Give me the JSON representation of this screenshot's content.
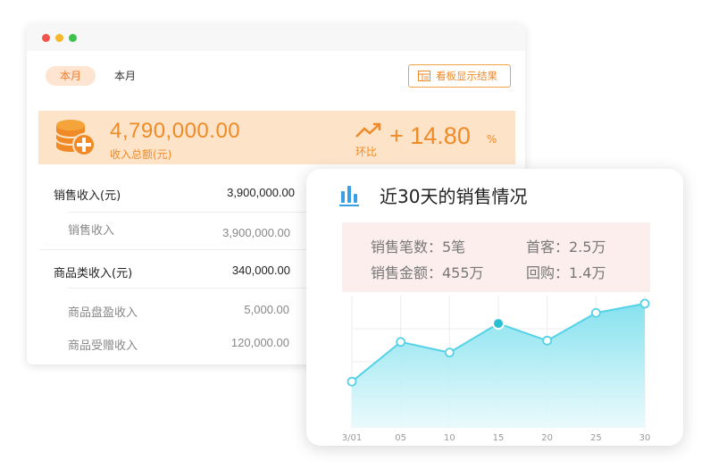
{
  "window": {
    "tabs": [
      "本月",
      "本月"
    ],
    "board_button": "看板显示结果",
    "summary": {
      "total_value": "4,790,000.00",
      "total_label": "收入总额(元)",
      "ratio_label": "环比",
      "ratio_value": "+ 14.80",
      "ratio_unit": "%"
    },
    "rows": [
      {
        "label": "销售收入(元)",
        "value": "3,900,000.00",
        "level": "main"
      },
      {
        "label": "销售收入",
        "value": "3,900,000.00",
        "level": "sub"
      },
      {
        "label": "商品类收入(元)",
        "value": "340,000.00",
        "level": "main"
      },
      {
        "label": "商品盘盈收入",
        "value": "5,000.00",
        "level": "sub"
      },
      {
        "label": "商品受赠收入",
        "value": "120,000.00",
        "level": "sub"
      }
    ],
    "colors": {
      "accent": "#f08a26",
      "pill_bg": "#fde5d2",
      "summary_bg": "#fde4c9"
    }
  },
  "card": {
    "title": "近30天的销售情况",
    "stats": {
      "count": "销售笔数：5笔",
      "first": "首客：2.5万",
      "amount": "销售金额：455万",
      "repeat": "回购：1.4万"
    },
    "colors": {
      "line": "#55d2e6",
      "fill_top": "#8fe3f0",
      "stats_bg": "#fdeeee",
      "icon": "#3aa0e6"
    }
  },
  "chart_data": {
    "type": "area",
    "x": [
      "3/01",
      "05",
      "10",
      "15",
      "20",
      "25",
      "30"
    ],
    "values": [
      0.35,
      0.65,
      0.57,
      0.79,
      0.66,
      0.87,
      0.94
    ],
    "highlight_index": 3,
    "ylim": [
      0,
      1
    ],
    "grid": true
  }
}
